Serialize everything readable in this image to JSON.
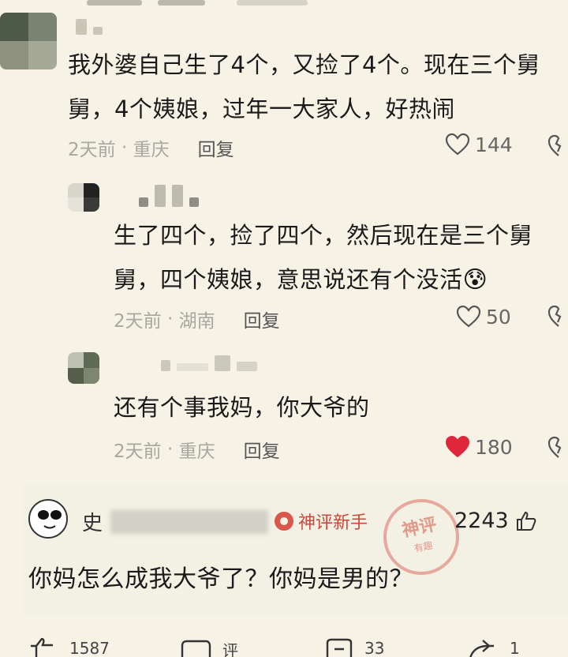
{
  "comments": [
    {
      "text_lines": [
        "我外婆自己生了4个，又捡了4个。现在三个舅",
        "舅，4个姨娘，过年一大家人，好热闹"
      ],
      "time": "2天前",
      "location": "重庆",
      "reply_label": "回复",
      "likes": "144",
      "liked": false
    },
    {
      "text_lines": [
        "生了四个，捡了四个，然后现在是三个舅",
        "舅，四个姨娘，意思说还有个没活"
      ],
      "emoji": "😰",
      "time": "2天前",
      "location": "湖南",
      "reply_label": "回复",
      "likes": "50",
      "liked": false
    },
    {
      "text_lines": [
        "还有个事我妈，你大爷的"
      ],
      "time": "2天前",
      "location": "重庆",
      "reply_label": "回复",
      "likes": "180",
      "liked": true
    }
  ],
  "featured": {
    "username_partial": "史",
    "badge": "神评新手",
    "stamp_main": "神评",
    "stamp_sub": "有趣",
    "likes": "2243",
    "text": "你妈怎么成我大爷了？你妈是男的？"
  },
  "bottom_bar": {
    "like_count": "1587",
    "comment_label": "评",
    "share_count": "33",
    "forward_count": "1"
  },
  "colors": {
    "background": "#f6f3e6",
    "liked_red": "#e0263a",
    "badge_red": "#c8493c"
  },
  "icons": [
    "heart-icon",
    "broken-heart-icon",
    "thumb-up-icon",
    "comment-icon",
    "share-icon",
    "forward-icon"
  ]
}
